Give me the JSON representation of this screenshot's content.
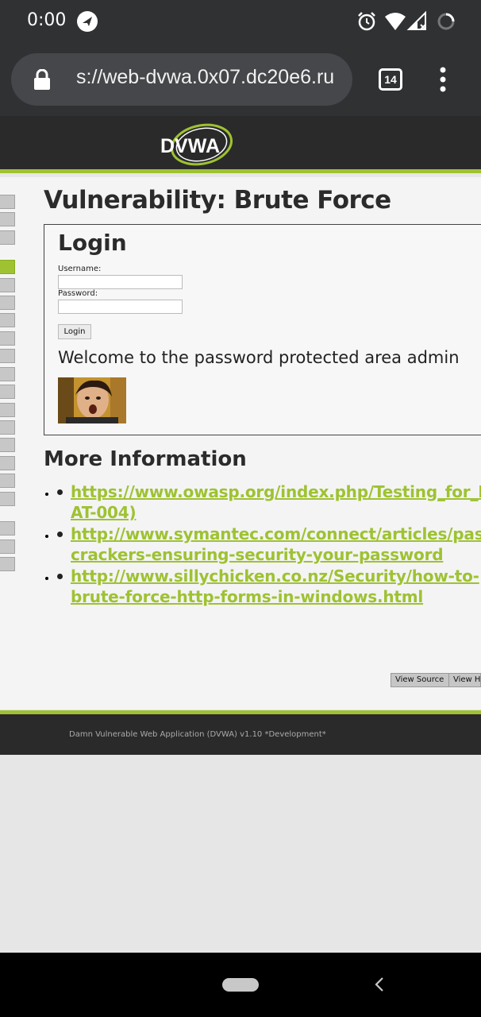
{
  "status_bar": {
    "time": "0:00",
    "icons": [
      "navigation-app-icon",
      "alarm-icon",
      "wifi-icon",
      "signal-icon",
      "loading-icon"
    ]
  },
  "browser": {
    "url": "s://web-dvwa.0x07.dc20e6.ru",
    "tab_count": "14",
    "icons": [
      "lock-icon",
      "overflow-menu-icon"
    ]
  },
  "header": {
    "logo_text": "DVWA",
    "accent_color": "#9ec232",
    "background_color": "#2a2a2a"
  },
  "sidebar": {
    "selected_index": 3,
    "item_count": 20
  },
  "main": {
    "title": "Vulnerability: Brute Force",
    "login": {
      "heading": "Login",
      "username_label": "Username:",
      "password_label": "Password:",
      "username_value": "",
      "password_value": "",
      "button_label": "Login",
      "welcome_message": "Welcome to the password protected area admin"
    },
    "more_info": {
      "heading": "More Information",
      "links": [
        {
          "lines": [
            "https://www.owasp.org/index.php/Testing_for_Bru",
            "AT-004)"
          ]
        },
        {
          "lines": [
            "http://www.symantec.com/connect/articles/passw",
            "crackers-ensuring-security-your-password"
          ]
        },
        {
          "lines": [
            "http://www.sillychicken.co.nz/Security/how-to-",
            "brute-force-http-forms-in-windows.html"
          ]
        }
      ]
    },
    "buttons": {
      "view_source": "View Source",
      "view_help": "View H"
    }
  },
  "footer": {
    "text": "Damn Vulnerable Web Application (DVWA) v1.10 *Development*"
  }
}
